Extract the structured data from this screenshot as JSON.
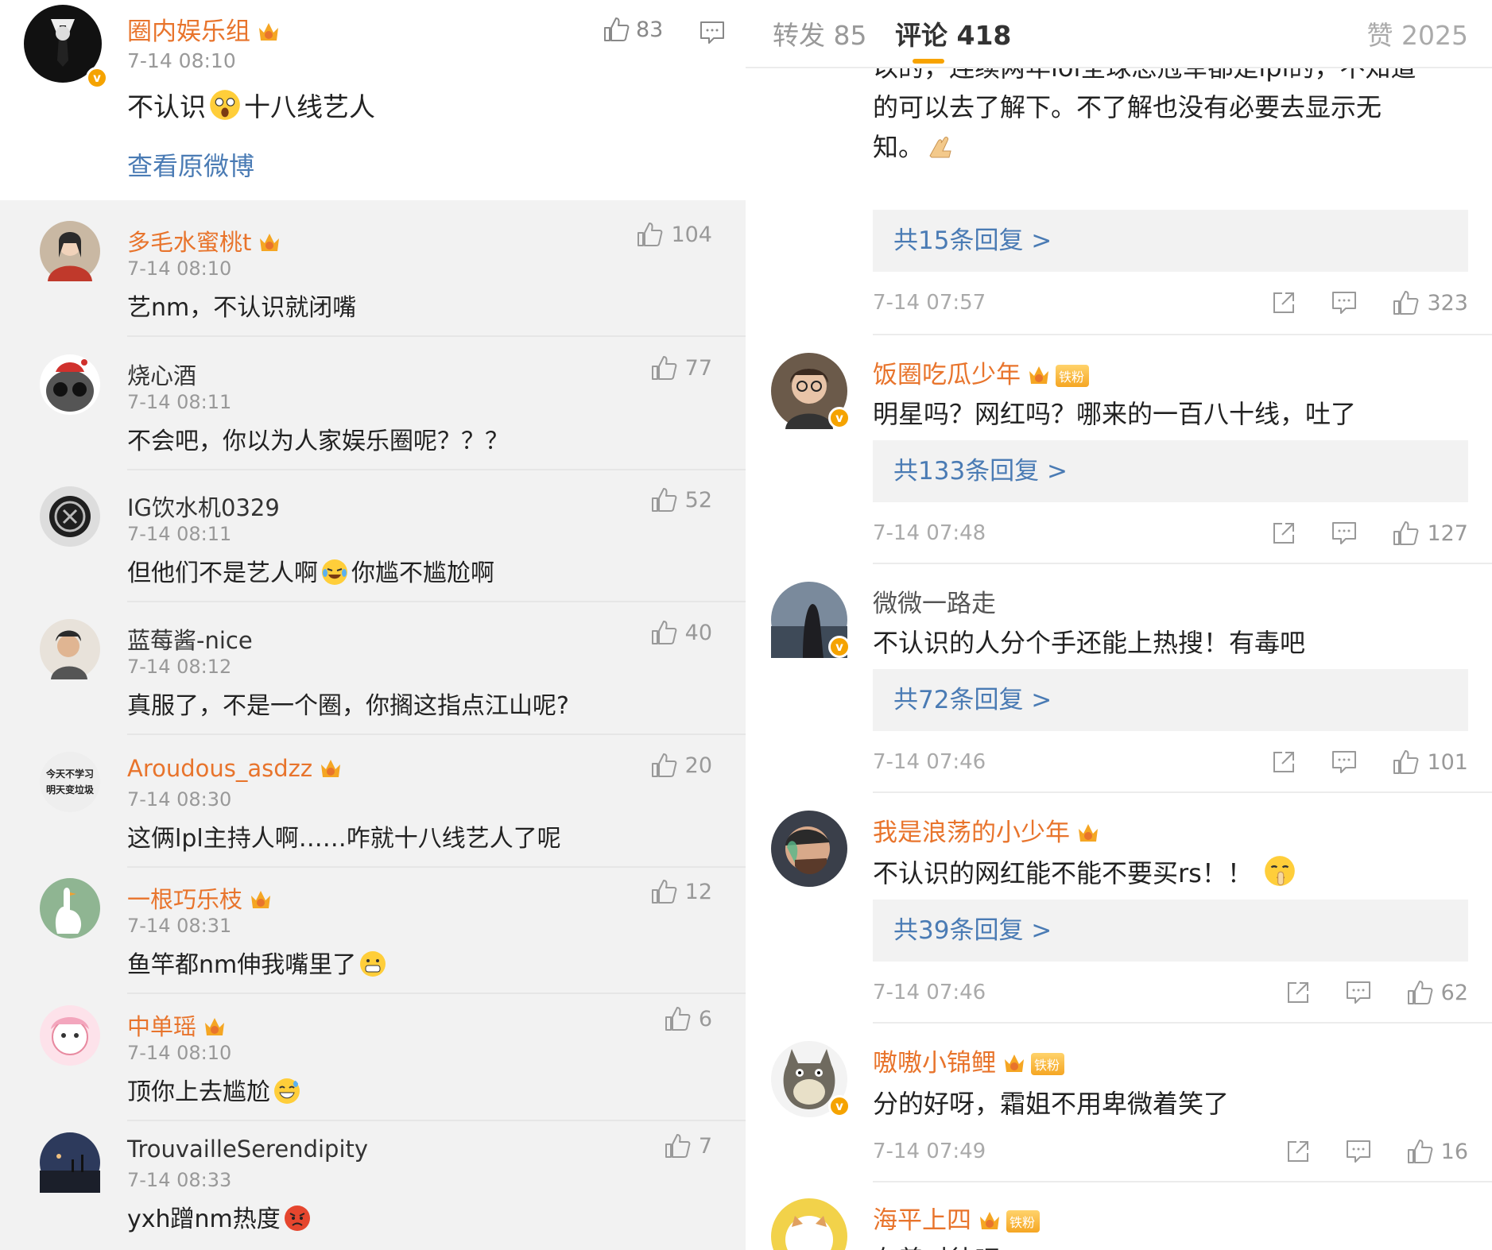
{
  "left": {
    "original_post": {
      "username": "圈内娱乐组",
      "time": "7-14 08:10",
      "text_before": "不认识",
      "text_after": "十八线艺人",
      "view_original": "查看原微博",
      "likes": "83"
    },
    "comments": [
      {
        "username": "多毛水蜜桃t",
        "time": "7-14 08:10",
        "text": "艺nm，不认识就闭嘴",
        "likes": "104",
        "orange": true
      },
      {
        "username": "烧心酒",
        "time": "7-14 08:11",
        "text": "不会吧，你以为人家娱乐圈呢？？？",
        "likes": "77",
        "orange": false
      },
      {
        "username": "IG饮水机0329",
        "time": "7-14 08:11",
        "text_before": "但他们不是艺人啊",
        "text_after": "你尴不尴尬啊",
        "likes": "52",
        "orange": false
      },
      {
        "username": "蓝莓酱-nice",
        "time": "7-14 08:12",
        "text": "真服了，不是一个圈，你搁这指点江山呢?",
        "likes": "40",
        "orange": false
      },
      {
        "username": "Aroudous_asdzz",
        "time": "7-14 08:30",
        "text": "这俩lpl主持人啊……咋就十八线艺人了呢",
        "likes": "20",
        "orange": true,
        "avatar_text": [
          "今天不学习",
          "明天变垃圾"
        ]
      },
      {
        "username": "一根巧乐枝",
        "time": "7-14 08:31",
        "text": "鱼竿都nm伸我嘴里了",
        "likes": "12",
        "orange": true
      },
      {
        "username": "中单瑶",
        "time": "7-14 08:10",
        "text": "顶你上去尴尬",
        "likes": "6",
        "orange": true
      },
      {
        "username": "TrouvailleSerendipity",
        "time": "7-14 08:33",
        "text": "yxh蹭nm热度",
        "likes": "7",
        "orange": false
      }
    ]
  },
  "right": {
    "tabs": {
      "repost": "转发 85",
      "comments": "评论 418",
      "praise": "赞 2025"
    },
    "continued_text": [
      "以的，连续两年lol全球总冠军都是lpl的，不知道",
      "的可以去了解下。不了解也没有必要去显示无",
      "知。"
    ],
    "first_block": {
      "replies": "共15条回复 >",
      "time": "7-14 07:57",
      "likes": "323"
    },
    "comments": [
      {
        "username": "饭圈吃瓜少年",
        "iron_fan": "铁粉",
        "text": "明星吗？网红吗？哪来的一百八十线，吐了",
        "replies": "共133条回复 >",
        "time": "7-14 07:48",
        "likes": "127"
      },
      {
        "username": "微微一路走",
        "text": "不认识的人分个手还能上热搜！有毒吧",
        "replies": "共72条回复 >",
        "time": "7-14 07:46",
        "likes": "101"
      },
      {
        "username": "我是浪荡的小少年",
        "text": "不认识的网红能不能不要买rs！！",
        "replies": "共39条回复 >",
        "time": "7-14 07:46",
        "likes": "62"
      },
      {
        "username": "嗷嗷小锦鲤",
        "iron_fan": "铁粉",
        "text": "分的好呀，霜姐不用卑微着笑了",
        "time": "7-14 07:49",
        "likes": "16"
      },
      {
        "username": "海平上四",
        "iron_fan": "铁粉",
        "text": "有善对待吧"
      }
    ]
  },
  "colors": {
    "username_orange": "#e8742c",
    "link_blue": "#4a7bb4",
    "accent": "#f7a300"
  }
}
